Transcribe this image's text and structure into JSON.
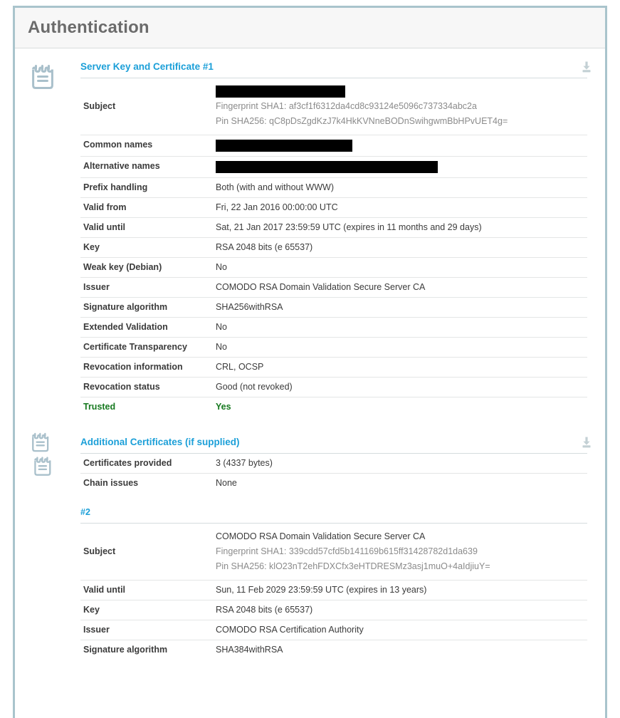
{
  "page": {
    "title": "Authentication",
    "accent_blue": "#1b9fd8",
    "trusted_green": "#16791f",
    "border_color": "#a9c4cc"
  },
  "sections": [
    {
      "id": "server-key-and-certificate-1",
      "title": "Server Key and Certificate #1",
      "icon": "certificate-icon",
      "download_icon": "download-icon",
      "rows": [
        {
          "label": "Subject",
          "type": "subject",
          "redacted": true,
          "redact_width": 182,
          "lines": [
            "Fingerprint SHA1: af3cf1f6312da4cd8c93124e5096c737334abc2a",
            "Pin SHA256: qC8pDsZgdKzJ7k4HkKVNneBODnSwihgwmBbHPvUET4g="
          ]
        },
        {
          "label": "Common names",
          "type": "redact",
          "redact_width": 192
        },
        {
          "label": "Alternative names",
          "type": "redact",
          "redact_width": 312
        },
        {
          "label": "Prefix handling",
          "value": "Both (with and without WWW)"
        },
        {
          "label": "Valid from",
          "value": "Fri, 22 Jan 2016 00:00:00 UTC"
        },
        {
          "label": "Valid until",
          "value": "Sat, 21 Jan 2017 23:59:59 UTC (expires in 11 months and 29 days)"
        },
        {
          "label": "Key",
          "value": "RSA 2048 bits (e 65537)"
        },
        {
          "label": "Weak key (Debian)",
          "value": "No"
        },
        {
          "label": "Issuer",
          "value": "COMODO RSA Domain Validation Secure Server CA"
        },
        {
          "label": "Signature algorithm",
          "value": "SHA256withRSA"
        },
        {
          "label": "Extended Validation",
          "value": "No"
        },
        {
          "label": "Certificate Transparency",
          "value": "No"
        },
        {
          "label": "Revocation information",
          "value": "CRL, OCSP"
        },
        {
          "label": "Revocation status",
          "value": "Good (not revoked)"
        },
        {
          "label": "Trusted",
          "value": "Yes",
          "status": "green"
        }
      ]
    },
    {
      "id": "additional-certificates",
      "title": "Additional Certificates (if supplied)",
      "icon": "certificates-pair-icon",
      "download_icon": "download-icon",
      "rows": [
        {
          "label": "Certificates provided",
          "value": "3 (4337 bytes)"
        },
        {
          "label": "Chain issues",
          "value": "None"
        }
      ],
      "sub_certificates": [
        {
          "title": "#2",
          "rows": [
            {
              "label": "Subject",
              "type": "subject",
              "redacted": false,
              "lines": [
                "COMODO RSA Domain Validation Secure Server CA",
                "Fingerprint SHA1: 339cdd57cfd5b141169b615ff31428782d1da639",
                "Pin SHA256: klO23nT2ehFDXCfx3eHTDRESMz3asj1muO+4aIdjiuY="
              ]
            },
            {
              "label": "Valid until",
              "value": "Sun, 11 Feb 2029 23:59:59 UTC (expires in 13 years)"
            },
            {
              "label": "Key",
              "value": "RSA 2048 bits (e 65537)"
            },
            {
              "label": "Issuer",
              "value": "COMODO RSA Certification Authority"
            },
            {
              "label": "Signature algorithm",
              "value": "SHA384withRSA"
            }
          ]
        }
      ]
    }
  ]
}
